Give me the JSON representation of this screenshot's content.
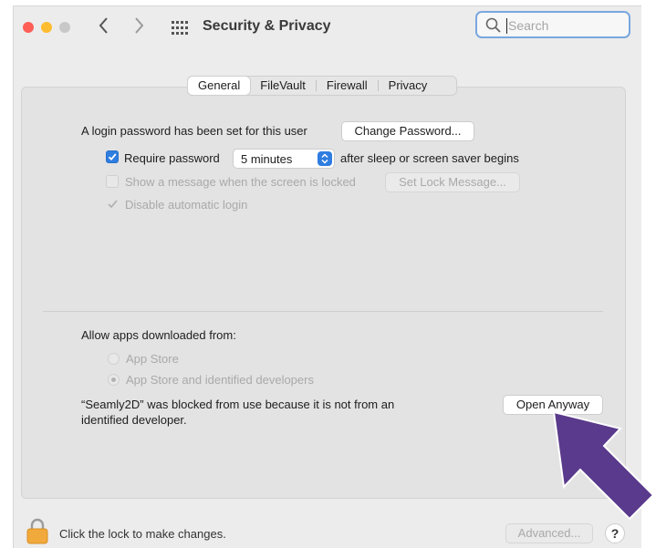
{
  "window": {
    "title": "Security & Privacy",
    "traffic_lights": {
      "close": "#ff5f57",
      "minimize": "#febc2e",
      "zoom": "#c8c8c8"
    }
  },
  "search": {
    "placeholder": "Search"
  },
  "tabs": [
    {
      "label": "General",
      "active": true
    },
    {
      "label": "FileVault",
      "active": false
    },
    {
      "label": "Firewall",
      "active": false
    },
    {
      "label": "Privacy",
      "active": false
    }
  ],
  "general": {
    "login_password_text": "A login password has been set for this user",
    "change_password_button": "Change Password...",
    "require_password": {
      "label": "Require password",
      "checked": true,
      "delay": "5 minutes",
      "suffix": "after sleep or screen saver begins"
    },
    "show_message": {
      "label": "Show a message when the screen is locked",
      "checked": false,
      "enabled": false
    },
    "set_lock_message_button": "Set Lock Message...",
    "disable_auto_login": {
      "label": "Disable automatic login",
      "checked": true,
      "enabled": false
    }
  },
  "downloads": {
    "heading": "Allow apps downloaded from:",
    "options": [
      {
        "label": "App Store",
        "selected": false
      },
      {
        "label": "App Store and identified developers",
        "selected": true
      }
    ],
    "blocked_message_line1": "“Seamly2D” was blocked from use because it is not from an",
    "blocked_message_line2": "identified developer.",
    "open_anyway_button": "Open Anyway"
  },
  "footer": {
    "lock_text": "Click the lock to make changes.",
    "advanced_button": "Advanced...",
    "help_button": "?"
  },
  "colors": {
    "accent": "#2f7de1",
    "arrow": "#5a3a8c"
  }
}
